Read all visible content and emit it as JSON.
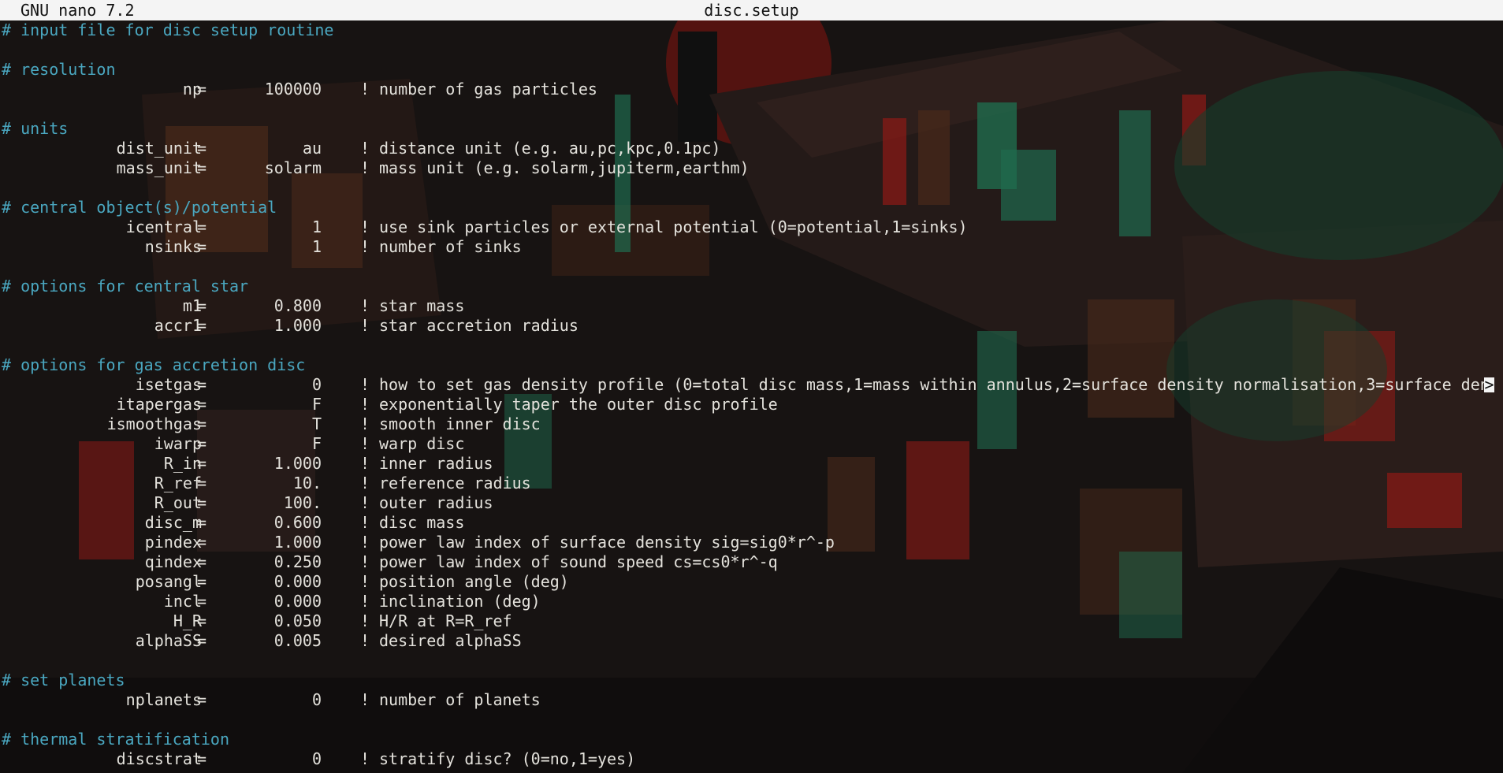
{
  "titlebar": {
    "app": "GNU nano 7.2",
    "filename": "disc.setup"
  },
  "colors": {
    "comment": "#4aa7c0",
    "text": "#e4e2dc",
    "titlebar_bg": "#f4f4f4",
    "background": "#161312",
    "accent_red": "#b8211c",
    "accent_green": "#1f6b4e"
  },
  "truncation_marker": ">",
  "lines": [
    {
      "type": "comment",
      "text": "# input file for disc setup routine"
    },
    {
      "type": "blank"
    },
    {
      "type": "comment",
      "text": "# resolution"
    },
    {
      "type": "param",
      "name": "np",
      "value": "100000",
      "desc": "number of gas particles"
    },
    {
      "type": "blank"
    },
    {
      "type": "comment",
      "text": "# units"
    },
    {
      "type": "param",
      "name": "dist_unit",
      "value": "au",
      "desc": "distance unit (e.g. au,pc,kpc,0.1pc)"
    },
    {
      "type": "param",
      "name": "mass_unit",
      "value": "solarm",
      "desc": "mass unit (e.g. solarm,jupiterm,earthm)"
    },
    {
      "type": "blank"
    },
    {
      "type": "comment",
      "text": "# central object(s)/potential"
    },
    {
      "type": "param",
      "name": "icentral",
      "value": "1",
      "desc": "use sink particles or external potential (0=potential,1=sinks)"
    },
    {
      "type": "param",
      "name": "nsinks",
      "value": "1",
      "desc": "number of sinks"
    },
    {
      "type": "blank"
    },
    {
      "type": "comment",
      "text": "# options for central star"
    },
    {
      "type": "param",
      "name": "m1",
      "value": "0.800",
      "desc": "star mass"
    },
    {
      "type": "param",
      "name": "accr1",
      "value": "1.000",
      "desc": "star accretion radius"
    },
    {
      "type": "blank"
    },
    {
      "type": "comment",
      "text": "# options for gas accretion disc"
    },
    {
      "type": "param",
      "name": "isetgas",
      "value": "0",
      "desc": "how to set gas density profile (0=total disc mass,1=mass within annulus,2=surface density normalisation,3=surface den",
      "truncated": true
    },
    {
      "type": "param",
      "name": "itapergas",
      "value": "F",
      "desc": "exponentially taper the outer disc profile"
    },
    {
      "type": "param",
      "name": "ismoothgas",
      "value": "T",
      "desc": "smooth inner disc"
    },
    {
      "type": "param",
      "name": "iwarp",
      "value": "F",
      "desc": "warp disc"
    },
    {
      "type": "param",
      "name": "R_in",
      "value": "1.000",
      "desc": "inner radius"
    },
    {
      "type": "param",
      "name": "R_ref",
      "value": "10.",
      "desc": "reference radius"
    },
    {
      "type": "param",
      "name": "R_out",
      "value": "100.",
      "desc": "outer radius"
    },
    {
      "type": "param",
      "name": "disc_m",
      "value": "0.600",
      "desc": "disc mass"
    },
    {
      "type": "param",
      "name": "pindex",
      "value": "1.000",
      "desc": "power law index of surface density sig=sig0*r^-p"
    },
    {
      "type": "param",
      "name": "qindex",
      "value": "0.250",
      "desc": "power law index of sound speed cs=cs0*r^-q"
    },
    {
      "type": "param",
      "name": "posangl",
      "value": "0.000",
      "desc": "position angle (deg)"
    },
    {
      "type": "param",
      "name": "incl",
      "value": "0.000",
      "desc": "inclination (deg)"
    },
    {
      "type": "param",
      "name": "H_R",
      "value": "0.050",
      "desc": "H/R at R=R_ref"
    },
    {
      "type": "param",
      "name": "alphaSS",
      "value": "0.005",
      "desc": "desired alphaSS"
    },
    {
      "type": "blank"
    },
    {
      "type": "comment",
      "text": "# set planets"
    },
    {
      "type": "param",
      "name": "nplanets",
      "value": "0",
      "desc": "number of planets"
    },
    {
      "type": "blank"
    },
    {
      "type": "comment",
      "text": "# thermal stratification"
    },
    {
      "type": "param",
      "name": "discstrat",
      "value": "0",
      "desc": "stratify disc? (0=no,1=yes)"
    }
  ]
}
